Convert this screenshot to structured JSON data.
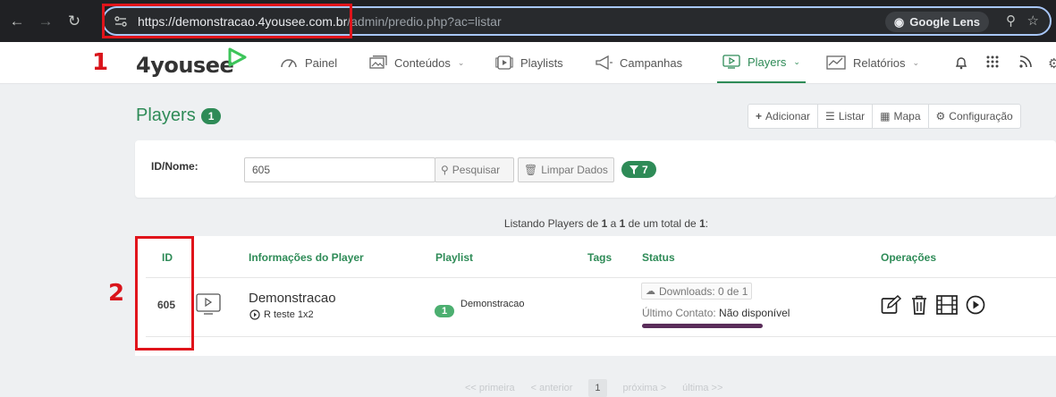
{
  "browser": {
    "url_host": "https://demonstracao.4yousee.com.br",
    "url_path": "/admin/predio.php?ac=listar",
    "lens_label": "Google Lens"
  },
  "annotations": {
    "label1": "1",
    "label2": "2"
  },
  "nav": {
    "logo": "4yousee",
    "items": [
      "Painel",
      "Conteúdos",
      "Playlists",
      "Campanhas",
      "Players",
      "Relatórios"
    ],
    "active": "Players"
  },
  "page": {
    "title": "Players",
    "count": "1",
    "buttons": [
      "Adicionar",
      "Listar",
      "Mapa",
      "Configuração"
    ]
  },
  "filter": {
    "label": "ID/Nome:",
    "value": "605",
    "search_label": "Pesquisar",
    "clear_label": "Limpar Dados",
    "filter_count": "7"
  },
  "listing": {
    "prefix": "Listando Players de ",
    "from": "1",
    "mid": " a ",
    "to": "1",
    "total_text": " de um total de ",
    "total": "1",
    "suffix": ":"
  },
  "table": {
    "headers": [
      "ID",
      "Informações do Player",
      "Playlist",
      "Tags",
      "Status",
      "Operações"
    ],
    "row": {
      "id": "605",
      "name": "Demonstracao",
      "sub": "R teste 1x2",
      "playlist_count": "1",
      "playlist_name": "Demonstracao",
      "downloads": "Downloads: 0 de 1",
      "contact_label": "Último Contato:",
      "contact_value": "Não disponível"
    }
  },
  "pager": {
    "first": "<< primeira",
    "prev": "< anterior",
    "current": "1",
    "next": "próxima >",
    "last": "última >>"
  },
  "colors": {
    "accent": "#2e8b57",
    "annotation": "#e0141b",
    "status_bar": "#5a2d5a"
  }
}
